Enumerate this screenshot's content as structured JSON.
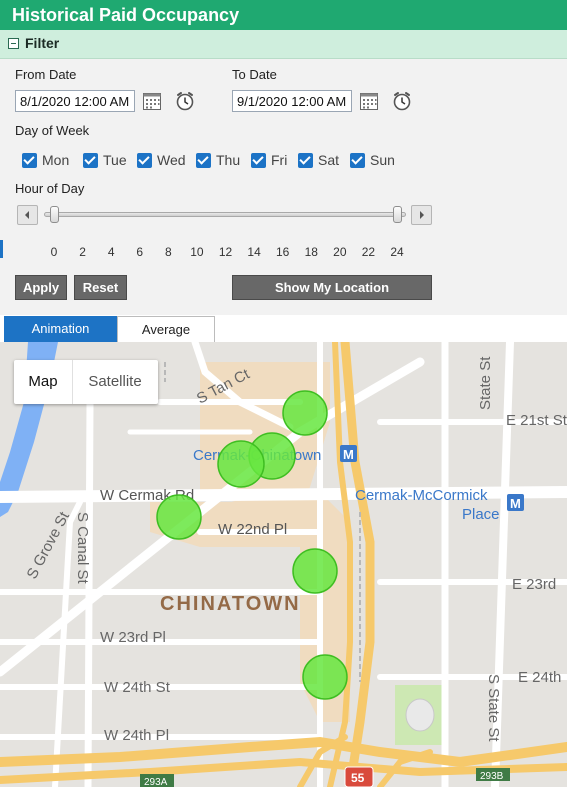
{
  "header": {
    "title": "Historical Paid Occupancy"
  },
  "filter": {
    "label": "Filter",
    "from_label": "From Date",
    "from_value": "8/1/2020 12:00 AM",
    "to_label": "To Date",
    "to_value": "9/1/2020 12:00 AM",
    "dow_label": "Day of Week",
    "days": [
      "Mon",
      "Tue",
      "Wed",
      "Thu",
      "Fri",
      "Sat",
      "Sun"
    ],
    "hour_label": "Hour of Day",
    "hour_range": {
      "min": 0,
      "max": 24,
      "low": 0,
      "high": 24
    },
    "ticks": [
      "0",
      "2",
      "4",
      "6",
      "8",
      "10",
      "12",
      "14",
      "16",
      "18",
      "20",
      "22",
      "24"
    ],
    "apply_label": "Apply",
    "reset_label": "Reset",
    "location_label": "Show My Location"
  },
  "tabs": {
    "animation": "Animation",
    "average": "Average"
  },
  "map": {
    "map_btn": "Map",
    "satellite_btn": "Satellite",
    "labels": {
      "s_tan_ct": "S Tan Ct",
      "state_st": "State St",
      "e_21st": "E 21st St",
      "cermak_chinatown": "Cermak-Chinatown",
      "w_cermak": "W Cermak Rd",
      "cermak_mccormick": "Cermak-McCormick",
      "place": "Place",
      "w_22nd": "W 22nd Pl",
      "s_grove": "S Grove St",
      "s_canal": "S Canal St",
      "e_23rd": "E 23rd",
      "chinatown": "CHINATOWN",
      "w_23rd": "W 23rd Pl",
      "e_24th": "E 24th",
      "w_24th_st": "W 24th St",
      "s_state_st": "S State St",
      "w_24th_pl": "W 24th Pl",
      "hwy_55": "55",
      "exit_293a": "293A",
      "exit_293b": "293B"
    },
    "colors": {
      "marker": "#66e640",
      "marker_stroke": "#3fbe22",
      "water": "#7fb1f5",
      "highway": "#f6c96b",
      "district": "#f0dcc0",
      "park": "#cde8b3"
    }
  }
}
